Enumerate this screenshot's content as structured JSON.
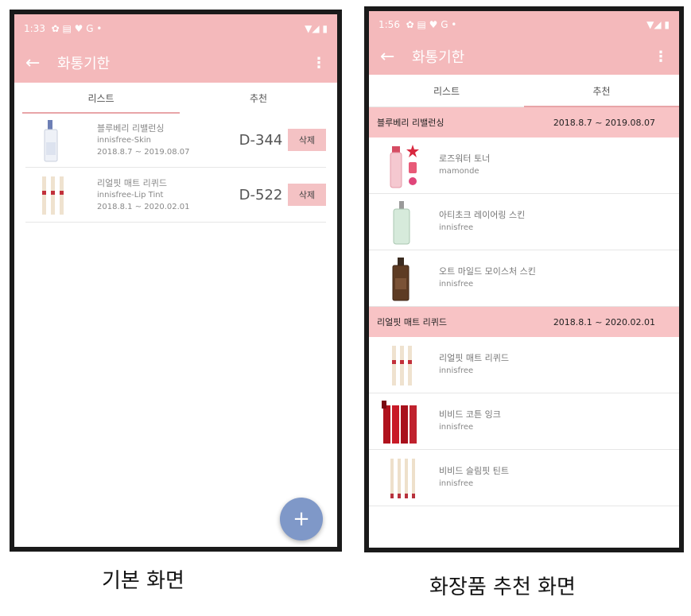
{
  "colors": {
    "header": "#f4b9bb",
    "group_header": "#f8c3c5",
    "delete_btn": "#f4c2c4",
    "fab": "#7f98c8"
  },
  "left": {
    "status": {
      "time": "1:33",
      "icons": "✿ ▤ ♥ G •",
      "right": "▼◢ ▮"
    },
    "appbar": {
      "back": "←",
      "title": "화통기한",
      "menu": "⋮"
    },
    "tabs": [
      "리스트",
      "추천"
    ],
    "items": [
      {
        "name": "블루베리 리밸런싱",
        "brand": "innisfree-Skin",
        "period": "2018.8.7 ~ 2019.08.07",
        "dday": "D-344",
        "delete": "삭제"
      },
      {
        "name": "리얼핏 매트 리퀴드",
        "brand": "innisfree-Lip Tint",
        "period": "2018.8.1 ~ 2020.02.01",
        "dday": "D-522",
        "delete": "삭제"
      }
    ],
    "fab": "+",
    "caption": "기본 화면"
  },
  "right": {
    "status": {
      "time": "1:56",
      "icons": "✿ ▤ ♥ G •",
      "right": "▼◢ ▮"
    },
    "appbar": {
      "back": "←",
      "title": "화통기한",
      "menu": "⋮"
    },
    "tabs": [
      "리스트",
      "추천"
    ],
    "groups": [
      {
        "name": "블루베리 리밸런싱",
        "period": "2018.8.7 ~ 2019.08.07",
        "items": [
          {
            "name": "로즈워터 토너",
            "brand": "mamonde"
          },
          {
            "name": "아티초크 레이어링 스킨",
            "brand": "innisfree"
          },
          {
            "name": "오트 마일드 모이스처 스킨",
            "brand": "innisfree"
          }
        ]
      },
      {
        "name": "리얼핏 매트 리퀴드",
        "period": "2018.8.1 ~ 2020.02.01",
        "items": [
          {
            "name": "리얼핏 매트 리퀴드",
            "brand": "innisfree"
          },
          {
            "name": "비비드 코튼 잉크",
            "brand": "innisfree"
          },
          {
            "name": "비비드 슬림핏 틴트",
            "brand": "innisfree"
          }
        ]
      }
    ],
    "caption": "화장품 추천 화면"
  }
}
